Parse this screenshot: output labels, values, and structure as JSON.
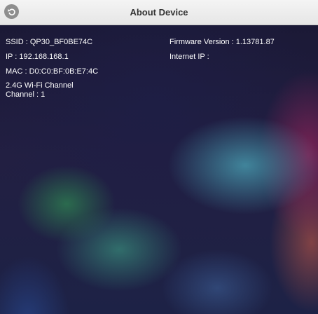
{
  "header": {
    "title": "About Device",
    "back_icon": "back-icon",
    "back_icon_color": "#8e8e8e"
  },
  "device_info": {
    "ssid": "SSID : QP30_BF0BE74C",
    "ip": "IP : 192.168.168.1",
    "mac": "MAC : D0:C0:BF:0B:E7:4C",
    "wifi_channel_line1": "2.4G Wi-Fi Channel",
    "wifi_channel_line2": "Channel : 1",
    "firmware_version": "Firmware Version : 1.13781.87",
    "internet_ip": "Internet IP :"
  },
  "colors": {
    "header_bg": "#eeeeee",
    "text": "#ffffff"
  }
}
